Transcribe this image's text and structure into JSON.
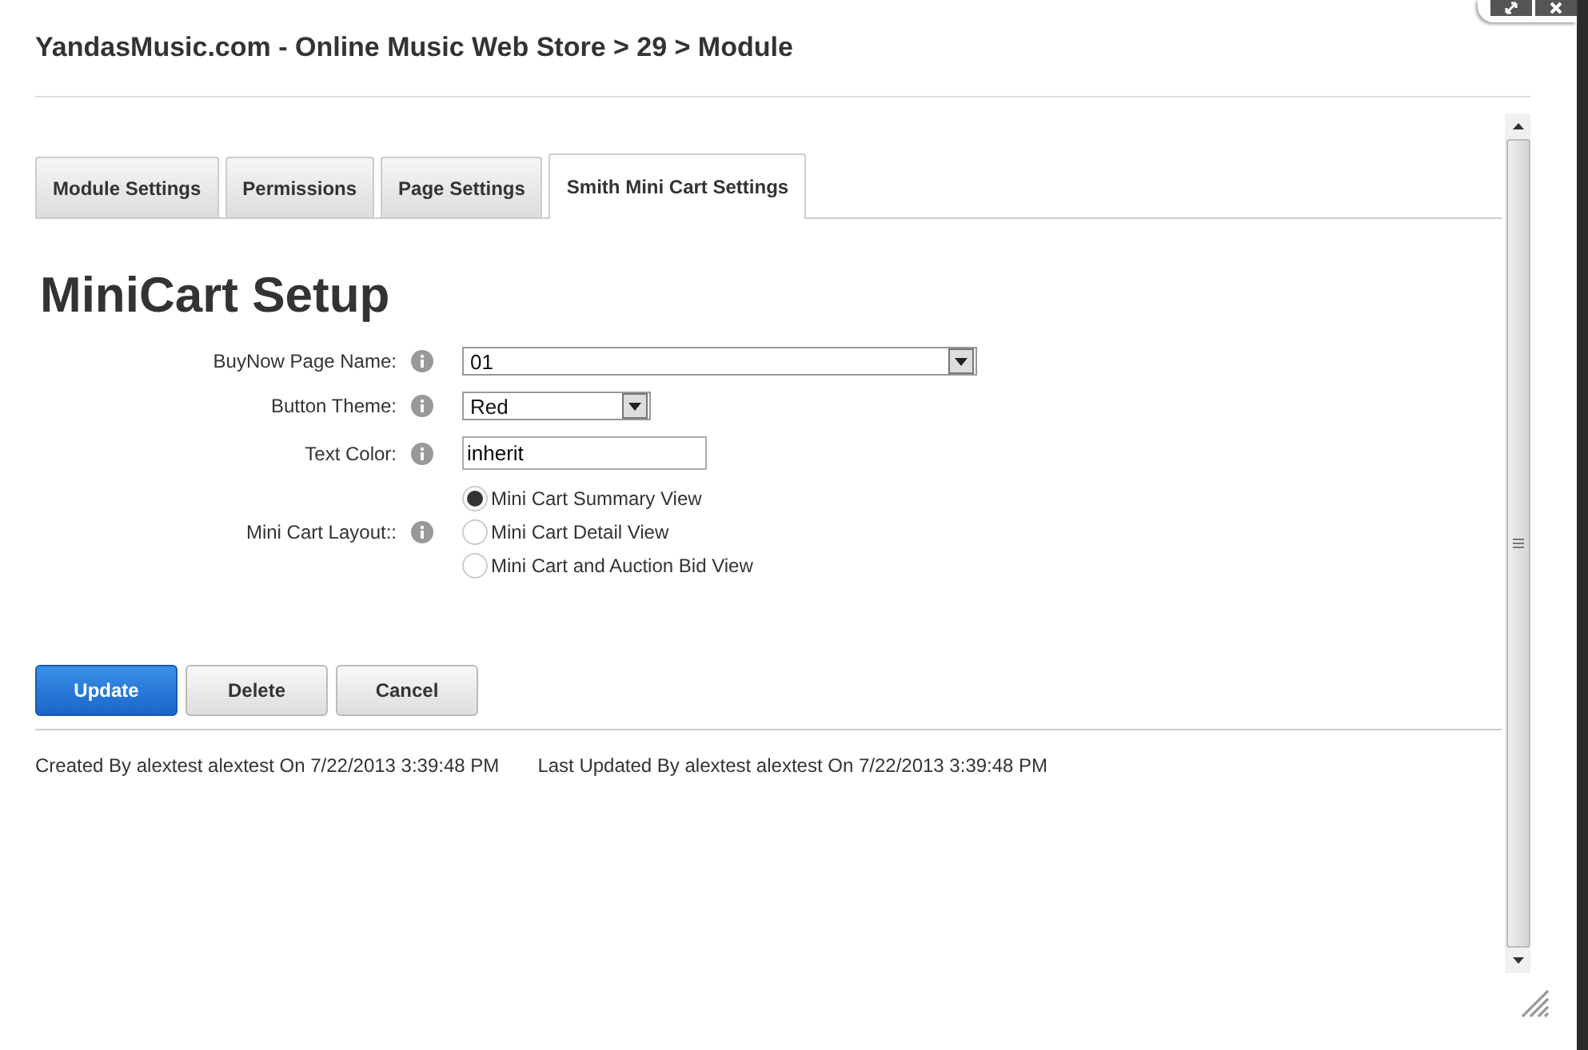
{
  "dialog": {
    "title": "YandasMusic.com - Online Music Web Store > 29 > Module"
  },
  "tabs": [
    {
      "label": "Module Settings",
      "selected": false
    },
    {
      "label": "Permissions",
      "selected": false
    },
    {
      "label": "Page Settings",
      "selected": false
    },
    {
      "label": "Smith Mini Cart Settings",
      "selected": true
    }
  ],
  "heading": "MiniCart Setup",
  "fields": [
    {
      "kind": "wide-select",
      "label": "BuyNow Page Name:",
      "value": "01"
    },
    {
      "kind": "select",
      "label": "Button Theme:",
      "value": "Red"
    },
    {
      "kind": "text",
      "label": "Text Color:",
      "value": "inherit"
    },
    {
      "kind": "radio",
      "label": "Mini Cart Layout::",
      "options": [
        {
          "label": "Mini Cart Summary View",
          "selected": true
        },
        {
          "label": "Mini Cart Detail View",
          "selected": false
        },
        {
          "label": "Mini Cart and Auction Bid View",
          "selected": false
        }
      ]
    }
  ],
  "buttons": [
    {
      "label": "Update",
      "kind": "primary"
    },
    {
      "label": "Delete",
      "kind": "secondary"
    },
    {
      "label": "Cancel",
      "kind": "secondary"
    }
  ],
  "footer": {
    "created": "Created By alextest alextest On 7/22/2013 3:39:48 PM",
    "updated": "Last Updated By alextest alextest On 7/22/2013 3:39:48 PM"
  }
}
